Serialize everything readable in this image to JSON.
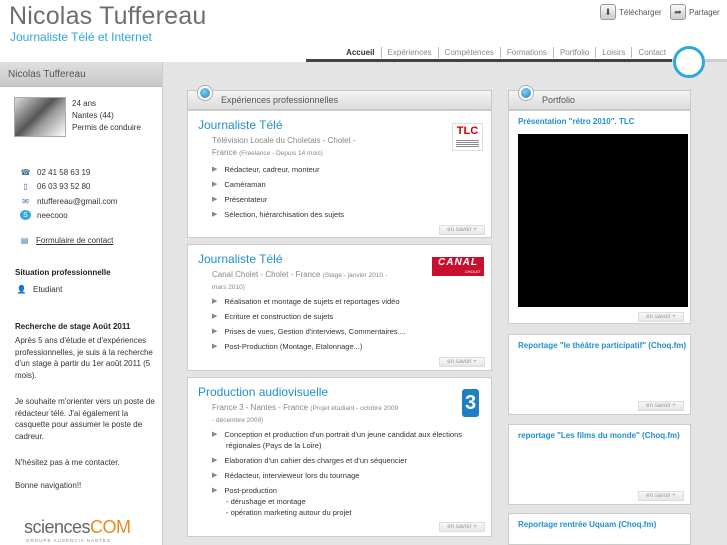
{
  "header": {
    "name": "Nicolas Tuffereau",
    "subtitle": "Journaliste Télé et Internet",
    "download": "Télécharger",
    "share": "Partager"
  },
  "nav": [
    "Accueil",
    "Expériences",
    "Compétences",
    "Formations",
    "Portfolio",
    "Loisirs",
    "Contact"
  ],
  "sidebar": {
    "title": "Nicolas Tuffereau",
    "info": [
      "24 ans",
      "Nantes (44)",
      "Permis de conduire"
    ],
    "contacts": [
      {
        "icon": "phone-icon",
        "text": "02 41 58 63 19"
      },
      {
        "icon": "mobile-icon",
        "text": "06 03 93 52 80"
      },
      {
        "icon": "email-icon",
        "text": "ntuffereau@gmail.com"
      },
      {
        "icon": "skype-icon",
        "text": "neecooo"
      }
    ],
    "form_link": "Formulaire de contact",
    "situation_title": "Situation professionnelle",
    "situation": "Etudiant",
    "stage_title": "Recherche de stage Août 2011",
    "stage_p1": "Après 5 ans d'étude et d'expériences professionnelles, je suis à la recherche d'un stage à partir du 1er août 2011 (5 mois).",
    "stage_p2": "Je souhaite m'orienter vers un poste de rédacteur télé. J'ai également la casquette pour assumer le poste de cadreur.",
    "stage_p3": "N'hésitez pas à me contacter.",
    "stage_p4": "Bonne navigation!!",
    "logo_main": "sciences",
    "logo_accent": "COM",
    "logo_sub": "GROUPE AUDENCIA NANTES"
  },
  "experiences": {
    "heading": "Expériences professionnelles",
    "more": "en savoir +",
    "items": [
      {
        "title": "Journaliste Télé",
        "sub1": "Télévision Locale du Choletais - Cholet -",
        "sub2": "France",
        "sub2_small": "(Freelance - Depuis 14 mois)",
        "logo": "TLC",
        "bullets": [
          "Rédacteur, cadreur, monteur",
          "Caméraman",
          "Présentateur",
          "Sélection, hiérarchisation des sujets"
        ]
      },
      {
        "title": "Journaliste Télé",
        "sub1": "Canal Cholet - Cholet - France",
        "sub1_small": "(Stage - janvier 2010 -",
        "sub2_small": "mars 2010)",
        "logo": "CANAL",
        "logo_sub": "CHOLET",
        "bullets": [
          "Réalisation et montage de sujets et reportages vidéo",
          "Ecriture et construction de sujets",
          "Prises de vues, Gestion d'interviews, Commentaires....",
          "Post-Production (Montage, Etalonnage...)"
        ]
      },
      {
        "title": "Production audiovisuelle",
        "sub1": "France 3 - Nantes - France",
        "sub1_small": "(Projet étudiant - octobre 2009",
        "sub2_small": "- décembre 2009)",
        "logo": "3",
        "bullets": [
          "Conception et production d'un portrait d'un jeune candidat aux élections",
          "régionales (Pays de la Loire)",
          "Elaboration d'un cahier des charges et d'un séquencier",
          "Rédacteur, intervieweur lors du tournage",
          "Post-production",
          "- dérushage et montage",
          "- opération marketing autour du projet"
        ]
      }
    ]
  },
  "portfolio": {
    "heading": "Portfolio",
    "more": "en savoir +",
    "items": [
      "Présentation \"rétro 2010\". TLC",
      "Reportage \"le théâtre participatif\" (Choq.fm)",
      "reportage \"Les films du monde\" (Choq.fm)",
      "Reportage rentrée Uquam (Choq.fm)"
    ]
  },
  "colors": {
    "accent": "#2ea8dc",
    "link": "#1f8fcf"
  }
}
